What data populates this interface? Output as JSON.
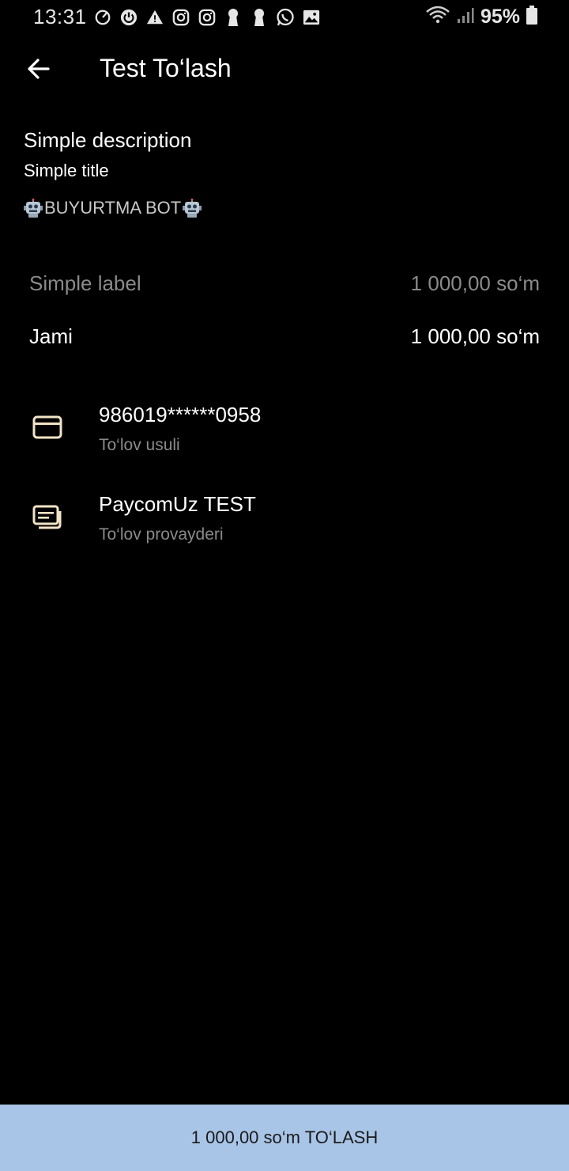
{
  "status_bar": {
    "time": "13:31",
    "battery": "95%",
    "notification_icons": [
      "sync-icon",
      "power-icon",
      "warning-icon",
      "instagram-icon",
      "instagram-icon",
      "keyhole-icon",
      "keyhole-icon",
      "whatsapp-icon",
      "image-icon"
    ]
  },
  "app_bar": {
    "title": "Test To‘lash"
  },
  "description": {
    "main": "Simple description",
    "title": "Simple title",
    "bot_name": "BUYURTMA BOT"
  },
  "prices": {
    "item_label": "Simple label",
    "item_amount": "1 000,00 so‘m",
    "total_label": "Jami",
    "total_amount": "1 000,00 so‘m"
  },
  "payment_method": {
    "value": "986019******0958",
    "label": "To‘lov usuli",
    "icon": "credit-card-icon"
  },
  "payment_provider": {
    "value": "PaycomUz TEST",
    "label": "To‘lov provayderi",
    "icon": "receipt-icon"
  },
  "pay_button": {
    "label": "1 000,00 so‘m TO‘LASH"
  },
  "colors": {
    "background": "#000000",
    "accent_icon": "#f2e3c6",
    "button_bg": "#a8c4e6",
    "muted_text": "#8a8a8a"
  }
}
